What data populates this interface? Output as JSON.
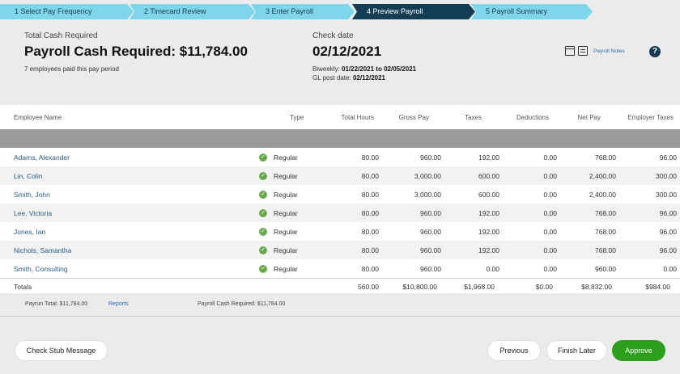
{
  "stepper": {
    "steps": [
      {
        "label": "1  Select Pay Frequency"
      },
      {
        "label": "2  Timecard Review"
      },
      {
        "label": "3  Enter Payroll"
      },
      {
        "label": "4  Preview Payroll"
      },
      {
        "label": "5  Payroll Summary"
      }
    ],
    "active_index": 3,
    "color_inactive": "#7dd6ea",
    "color_active": "#123d52"
  },
  "header": {
    "total_cash_label": "Total Cash Required",
    "payroll_cash_title": "Payroll Cash Required: $11,784.00",
    "employees_paid": "7 employees paid this pay period",
    "check_date_label": "Check date",
    "check_date": "02/12/2021",
    "biweekly_label": "Biweekly:",
    "biweekly_value": "01/22/2021 to 02/05/2021",
    "gl_label": "GL post date:",
    "gl_value": "02/12/2021",
    "payroll_notes": "Payroll Notes",
    "help_icon": "?"
  },
  "table": {
    "columns": [
      "Employee Name",
      "Type",
      "Total Hours",
      "Gross Pay",
      "Taxes",
      "Deductions",
      "Net Pay",
      "Employer Taxes"
    ],
    "rows": [
      {
        "name": "Adams, Alexander",
        "type": "Regular",
        "hours": "80.00",
        "gross": "960.00",
        "taxes": "192.00",
        "deductions": "0.00",
        "net": "768.00",
        "employer": "96.00"
      },
      {
        "name": "Lin, Colin",
        "type": "Regular",
        "hours": "80.00",
        "gross": "3,000.00",
        "taxes": "600.00",
        "deductions": "0.00",
        "net": "2,400.00",
        "employer": "300.00"
      },
      {
        "name": "Smith, John",
        "type": "Regular",
        "hours": "80.00",
        "gross": "3,000.00",
        "taxes": "600.00",
        "deductions": "0.00",
        "net": "2,400.00",
        "employer": "300.00"
      },
      {
        "name": "Lee, Victoria",
        "type": "Regular",
        "hours": "80.00",
        "gross": "960.00",
        "taxes": "192.00",
        "deductions": "0.00",
        "net": "768.00",
        "employer": "96.00"
      },
      {
        "name": "Jones, Ian",
        "type": "Regular",
        "hours": "80.00",
        "gross": "960.00",
        "taxes": "192.00",
        "deductions": "0.00",
        "net": "768.00",
        "employer": "96.00"
      },
      {
        "name": "Nichols, Samantha",
        "type": "Regular",
        "hours": "80.00",
        "gross": "960.00",
        "taxes": "192.00",
        "deductions": "0.00",
        "net": "768.00",
        "employer": "96.00"
      },
      {
        "name": "Smith, Consulting",
        "type": "Regular",
        "hours": "80.00",
        "gross": "960.00",
        "taxes": "0.00",
        "deductions": "0.00",
        "net": "960.00",
        "employer": "0.00"
      }
    ],
    "totals": {
      "label": "Totals",
      "hours": "560.00",
      "gross": "$10,800.00",
      "taxes": "$1,968.00",
      "deductions": "$0.00",
      "net": "$8,832.00",
      "employer": "$984.00"
    }
  },
  "summary": {
    "payrun_total": "Payrun Total: $11,784.00",
    "reports": "Reports",
    "payroll_cash": "Payroll Cash Required: $11,784.00"
  },
  "buttons": {
    "check_stub": "Check Stub Message",
    "previous": "Previous",
    "finish_later": "Finish Later",
    "approve": "Approve"
  },
  "colors": {
    "approve": "#2ca01c",
    "link": "#2a5a85",
    "check": "#6aa84f"
  }
}
